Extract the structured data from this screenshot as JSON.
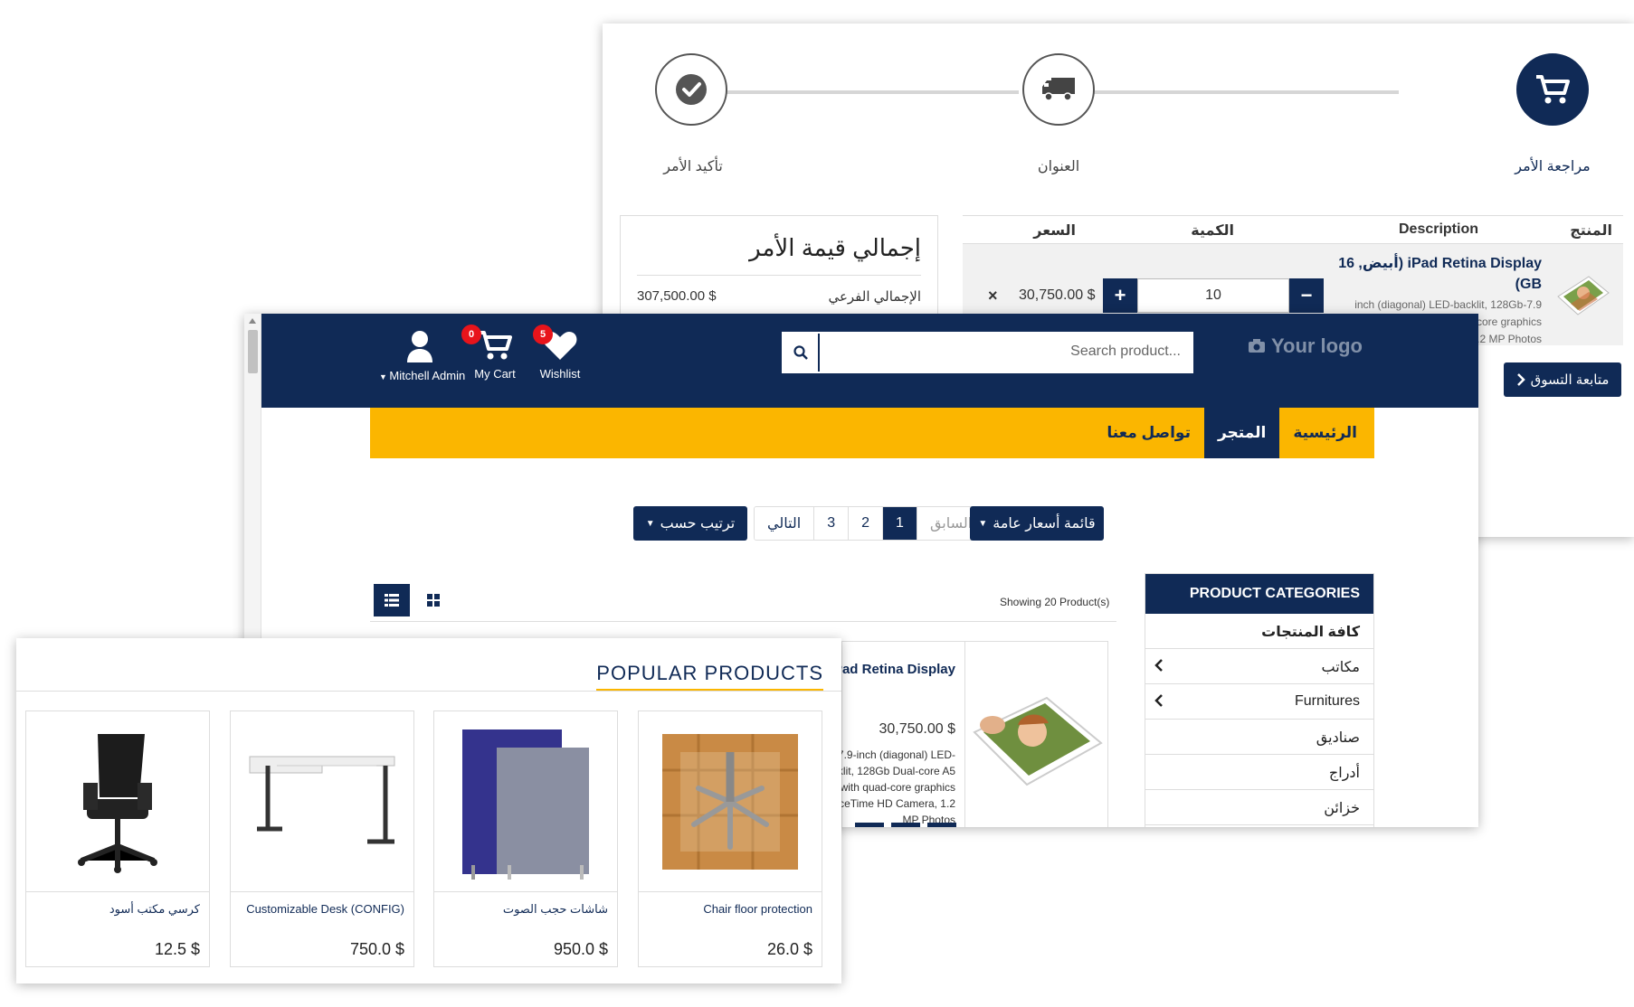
{
  "checkout": {
    "steps": [
      {
        "label": "مراجعة الأمر",
        "icon": "cart-icon",
        "active": true
      },
      {
        "label": "العنوان",
        "icon": "truck-icon",
        "active": false
      },
      {
        "label": "تأكيد الأمر",
        "icon": "check-icon",
        "active": false
      }
    ],
    "summary": {
      "title": "إجمالي قيمة الأمر",
      "subtotal_label": "الإجمالي الفرعي",
      "subtotal_value": "307,500.00 $"
    },
    "table": {
      "headers": {
        "product": "المنتج",
        "description": "Description",
        "quantity": "الكمية",
        "price": "السعر"
      },
      "row": {
        "name": "iPad Retina Display (أبيض, 16 GB)",
        "description": "7.9-inch (diagonal) LED-backlit, 128Gb Dual-core A5 with quad-core graphics FaceTime HD Camera, 1.2 MP Photos",
        "quantity": "10",
        "price": "30,750.00 $",
        "remove": "×",
        "minus": "−",
        "plus": "+"
      }
    },
    "continue_label": "متابعة التسوق"
  },
  "shop": {
    "logo": "Your logo",
    "search_placeholder": "Search product...",
    "user_label": "Mitchell Admin",
    "cart_label": "My Cart",
    "cart_count": "0",
    "wishlist_label": "Wishlist",
    "wishlist_count": "5",
    "nav": [
      {
        "label": "الرئيسية",
        "active": false
      },
      {
        "label": "المتجر",
        "active": true
      },
      {
        "label": "تواصل معنا",
        "active": false
      }
    ],
    "sort_label": "ترتيب حسب",
    "pricelist_label": "قائمة أسعار عامة",
    "pager": {
      "prev": "السابق",
      "pages": [
        "1",
        "2",
        "3"
      ],
      "next": "التالي",
      "current": "1"
    },
    "showing": "Showing 20 Product(s)",
    "product": {
      "name": "iPad Retina Display",
      "price": "30,750.00 $",
      "desc": "7.9-inch (diagonal) LED-backlit, 128Gb Dual-core A5 with quad-core graphics FaceTime HD Camera, 1.2 MP Photos"
    },
    "categories": {
      "title": "PRODUCT CATEGORIES",
      "all": "كافة المنتجات",
      "items": [
        "مكاتب",
        "Furnitures",
        "صناديق",
        "أدراج",
        "خزائن"
      ]
    }
  },
  "popular": {
    "title": "POPULAR PRODUCTS",
    "items": [
      {
        "name": "Chair floor protection",
        "price": "26.0 $"
      },
      {
        "name": "شاشات حجب الصوت",
        "price": "950.0 $"
      },
      {
        "name": "Customizable Desk (CONFIG)",
        "price": "750.0 $"
      },
      {
        "name": "كرسي مكتب أسود",
        "price": "12.5 $"
      }
    ]
  },
  "colors": {
    "primary": "#102a56",
    "accent": "#fbb600",
    "badge": "#e8141b"
  }
}
